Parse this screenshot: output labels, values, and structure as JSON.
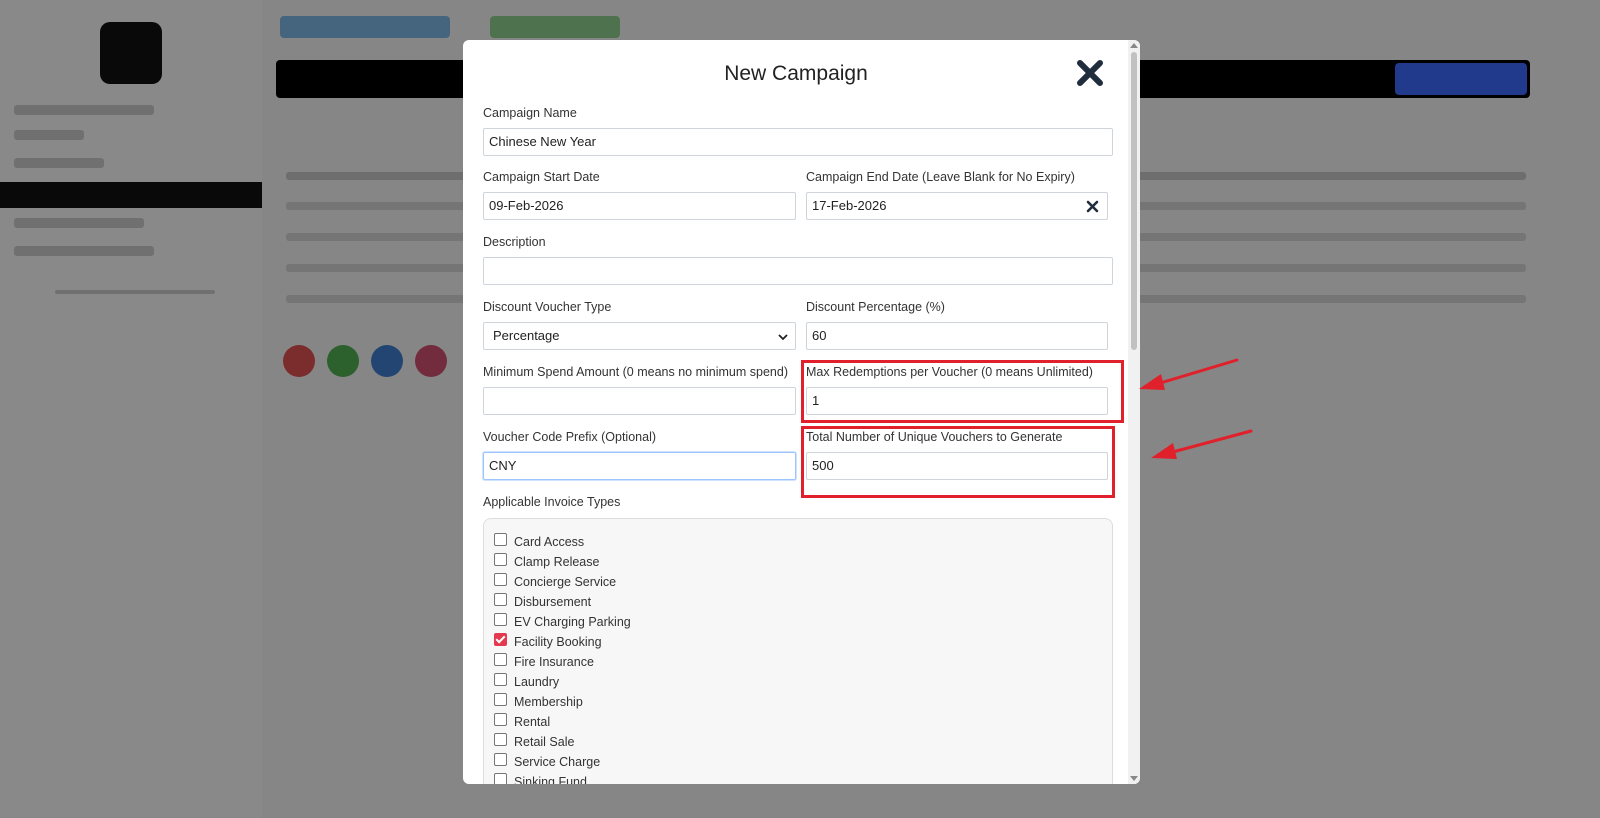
{
  "modal": {
    "title": "New Campaign",
    "fields": {
      "campaign_name": {
        "label": "Campaign Name",
        "value": "Chinese New Year"
      },
      "start_date": {
        "label": "Campaign Start Date",
        "value": "09-Feb-2026"
      },
      "end_date": {
        "label": "Campaign End Date (Leave Blank for No Expiry)",
        "value": "17-Feb-2026"
      },
      "description": {
        "label": "Description",
        "value": ""
      },
      "voucher_type": {
        "label": "Discount Voucher Type",
        "value": "Percentage"
      },
      "discount_percentage": {
        "label": "Discount Percentage (%)",
        "value": "60"
      },
      "min_spend": {
        "label": "Minimum Spend Amount (0 means no minimum spend)",
        "value": ""
      },
      "max_redemptions": {
        "label": "Max Redemptions per Voucher (0 means Unlimited)",
        "value": "1"
      },
      "code_prefix": {
        "label": "Voucher Code Prefix (Optional)",
        "value": "CNY"
      },
      "total_vouchers": {
        "label": "Total Number of Unique Vouchers to Generate",
        "value": "500"
      }
    },
    "invoice_types": {
      "label": "Applicable Invoice Types",
      "items": [
        {
          "label": "Card Access",
          "checked": false
        },
        {
          "label": "Clamp Release",
          "checked": false
        },
        {
          "label": "Concierge Service",
          "checked": false
        },
        {
          "label": "Disbursement",
          "checked": false
        },
        {
          "label": "EV Charging Parking",
          "checked": false
        },
        {
          "label": "Facility Booking",
          "checked": true
        },
        {
          "label": "Fire Insurance",
          "checked": false
        },
        {
          "label": "Laundry",
          "checked": false
        },
        {
          "label": "Membership",
          "checked": false
        },
        {
          "label": "Rental",
          "checked": false
        },
        {
          "label": "Retail Sale",
          "checked": false
        },
        {
          "label": "Service Charge",
          "checked": false
        },
        {
          "label": "Sinking Fund",
          "checked": false
        }
      ]
    }
  },
  "annotations": {
    "highlight_color": "#e0202a"
  },
  "icons": {
    "close": "close-icon",
    "clear": "clear-icon",
    "dropdown": "chevron-down-icon"
  },
  "colors": {
    "accent_checkbox": "#e53950",
    "overlay": "rgba(0,0,0,0.45)"
  }
}
